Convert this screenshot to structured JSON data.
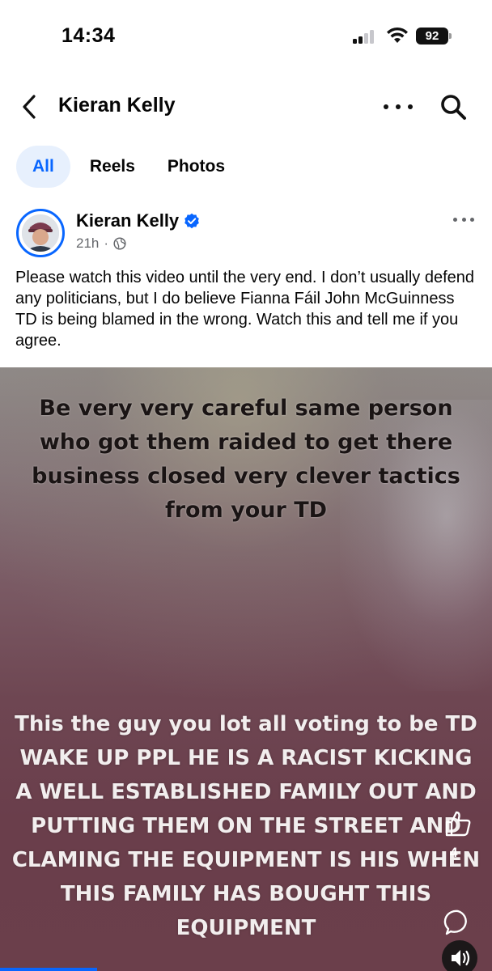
{
  "status_bar": {
    "time": "14:34",
    "battery": "92"
  },
  "header": {
    "title": "Kieran Kelly"
  },
  "tabs": [
    {
      "label": "All",
      "active": true
    },
    {
      "label": "Reels",
      "active": false
    },
    {
      "label": "Photos",
      "active": false
    }
  ],
  "post": {
    "author": "Kieran Kelly",
    "verified": true,
    "time": "21h",
    "separator": "·",
    "caption": "Please watch this video until the very end. I don’t usually defend any politicians, but I do believe Fianna Fáil John McGuinness TD is being blamed in the wrong. Watch this and tell me if you agree.",
    "video": {
      "overlay_text_top": "Be very very careful same person who got them raided to get there business closed very clever tactics from your TD",
      "overlay_text_bottom": "This the guy you lot all voting to be TD WAKE UP PPL HE IS A RACIST KICKING A WELL ESTABLISHED FAMILY OUT AND PUTTING THEM ON THE STREET AND CLAMING THE EQUIPMENT IS HIS WHEN THIS FAMILY HAS BOUGHT THIS EQUIPMENT",
      "like_count": "4"
    }
  },
  "colors": {
    "accent": "#0866ff",
    "active_tab_bg": "#e7f0fd",
    "secondary_text": "#65676b"
  },
  "icons": [
    "back-arrow-icon",
    "more-dots-icon",
    "search-icon",
    "verified-badge-icon",
    "globe-icon",
    "like-icon",
    "comment-icon",
    "volume-icon"
  ]
}
